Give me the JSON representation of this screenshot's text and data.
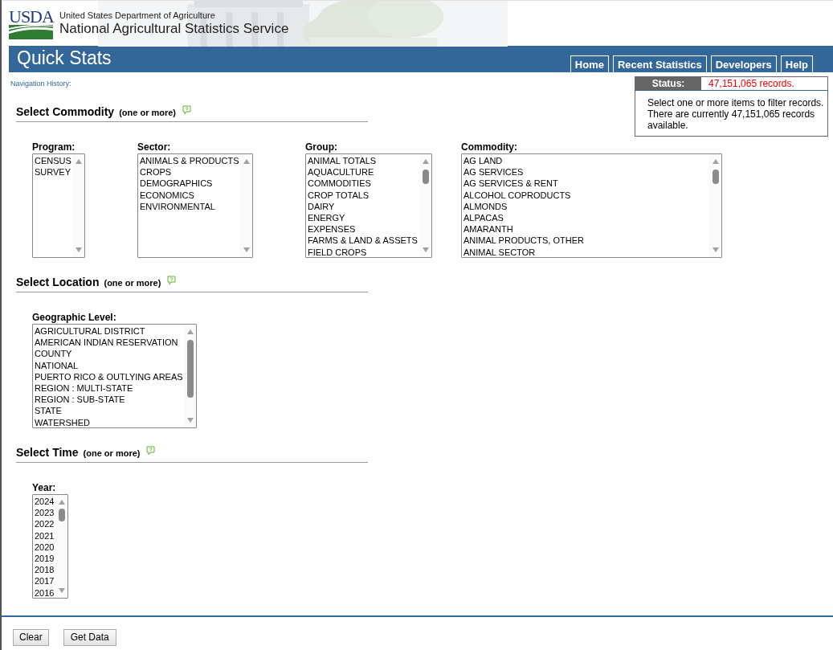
{
  "header": {
    "logo": "USDA",
    "department": "United States Department of Agriculture",
    "service": "National Agricultural Statistics Service"
  },
  "banner": {
    "title": "Quick Stats",
    "nav": [
      {
        "label": "Home",
        "selected": false
      },
      {
        "label": "Recent Statistics",
        "selected": false
      },
      {
        "label": "Developers",
        "selected": false
      },
      {
        "label": "Help",
        "selected": false
      }
    ]
  },
  "navigation_history": "Navigation History:",
  "status": {
    "label": "Status:",
    "count": "47,151,065 records.",
    "message": "Select one or more items to filter records. There are currently 47,151,065 records available."
  },
  "sections": [
    {
      "title": "Select Commodity",
      "hint": "(one or more)",
      "lists": [
        {
          "label": "Program:",
          "items": [
            "CENSUS",
            "SURVEY"
          ]
        },
        {
          "label": "Sector:",
          "items": [
            "ANIMALS & PRODUCTS",
            "CROPS",
            "DEMOGRAPHICS",
            "ECONOMICS",
            "ENVIRONMENTAL"
          ]
        },
        {
          "label": "Group:",
          "items": [
            "ANIMAL TOTALS",
            "AQUACULTURE",
            "COMMODITIES",
            "CROP TOTALS",
            "DAIRY",
            "ENERGY",
            "EXPENSES",
            "FARMS & LAND & ASSETS",
            "FIELD CROPS"
          ]
        },
        {
          "label": "Commodity:",
          "items": [
            "AG LAND",
            "AG SERVICES",
            "AG SERVICES & RENT",
            "ALCOHOL COPRODUCTS",
            "ALMONDS",
            "ALPACAS",
            "AMARANTH",
            "ANIMAL PRODUCTS, OTHER",
            "ANIMAL SECTOR"
          ]
        }
      ]
    },
    {
      "title": "Select Location",
      "hint": "(one or more)",
      "lists": [
        {
          "label": "Geographic Level:",
          "items": [
            "AGRICULTURAL DISTRICT",
            "AMERICAN INDIAN RESERVATION",
            "COUNTY",
            "NATIONAL",
            "PUERTO RICO & OUTLYING AREAS",
            "REGION : MULTI-STATE",
            "REGION : SUB-STATE",
            "STATE",
            "WATERSHED"
          ]
        }
      ]
    },
    {
      "title": "Select Time",
      "hint": "(one or more)",
      "lists": [
        {
          "label": "Year:",
          "items": [
            "2024",
            "2023",
            "2022",
            "2021",
            "2020",
            "2019",
            "2018",
            "2017",
            "2016"
          ]
        }
      ]
    }
  ],
  "buttons": [
    "Clear",
    "Get Data"
  ]
}
